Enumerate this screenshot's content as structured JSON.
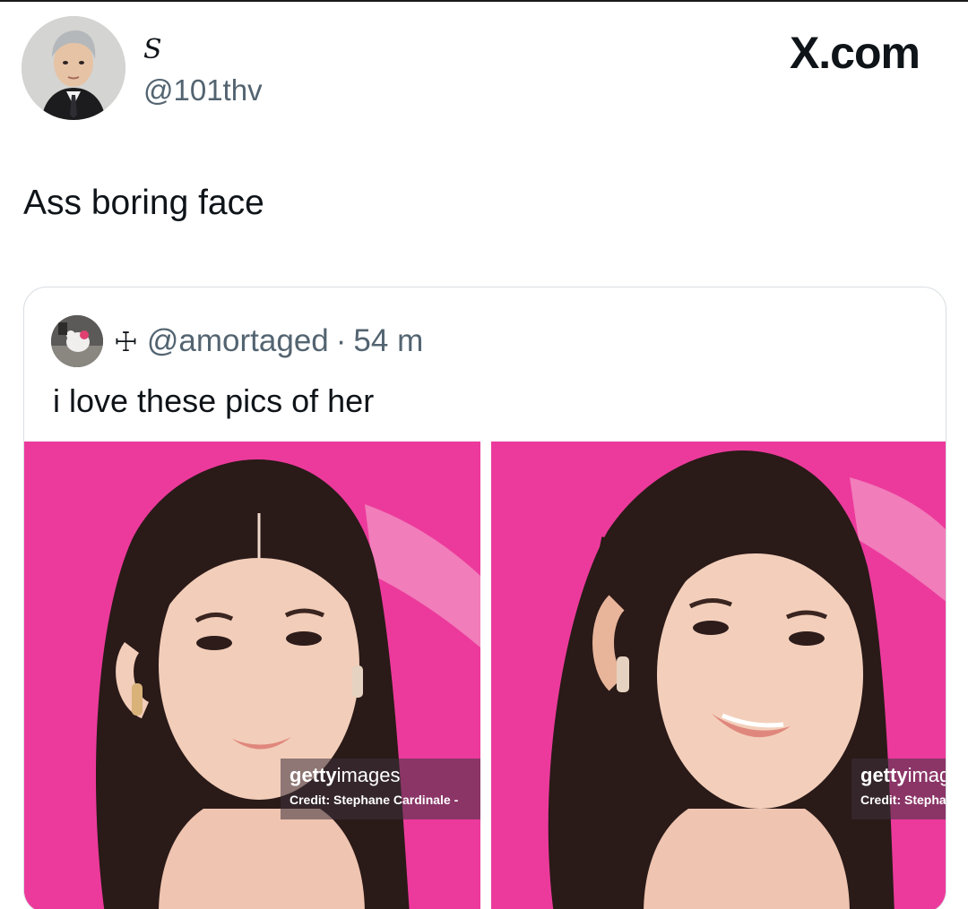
{
  "header": {
    "display_name": "S",
    "handle": "@101thv",
    "brand": "X.com"
  },
  "tweet": {
    "text": "Ass boring face"
  },
  "quote": {
    "dagger": "☩",
    "handle": "@amortaged",
    "separator": "·",
    "time": "54 m",
    "text": "i love these pics of her",
    "images": [
      {
        "watermark_brand_bold": "getty",
        "watermark_brand_thin": "images",
        "watermark_credit": "Credit: Stephane Cardinale -"
      },
      {
        "watermark_brand_bold": "getty",
        "watermark_brand_thin": "imag",
        "watermark_credit": "Credit: Stepha"
      }
    ]
  },
  "colors": {
    "text_primary": "#0f1419",
    "text_secondary": "#536471",
    "card_border": "#d9dee2",
    "photo_background": "#ec3a9c"
  }
}
